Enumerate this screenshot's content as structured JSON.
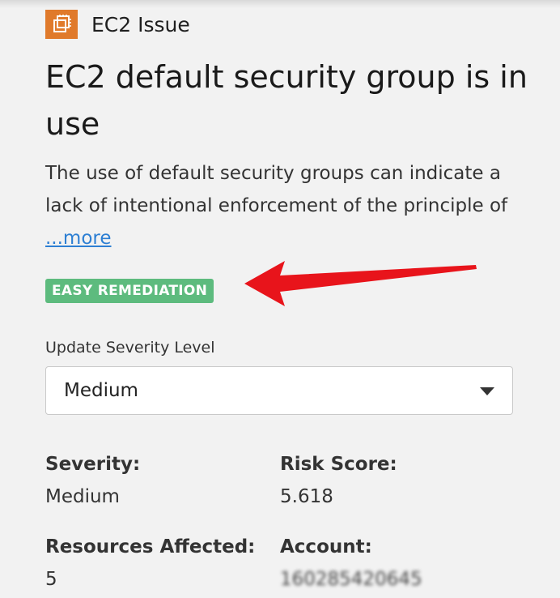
{
  "header": {
    "icon": "ec2-icon",
    "title": "EC2 Issue"
  },
  "issue": {
    "title": "EC2 default security group is in use",
    "description": "The use of default security groups can indicate a lack of intentional enforcement of the principle of",
    "more_link": "...more",
    "badge": "EASY REMEDIATION"
  },
  "severity_select": {
    "label": "Update Severity Level",
    "value": "Medium"
  },
  "details": {
    "severity_label": "Severity:",
    "severity_value": "Medium",
    "risk_score_label": "Risk Score:",
    "risk_score_value": "5.618",
    "resources_label": "Resources Affected:",
    "resources_value": "5",
    "account_label": "Account:",
    "account_value": "160285420645"
  },
  "colors": {
    "icon_bg": "#e07a2b",
    "badge_bg": "#5dbb7e",
    "link": "#2d7fd3",
    "arrow": "#e8141b"
  }
}
